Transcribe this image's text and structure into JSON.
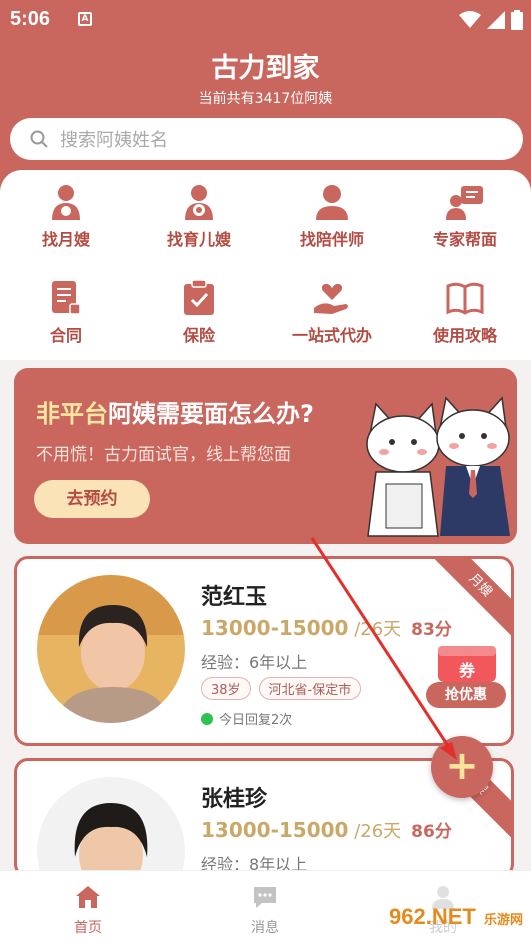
{
  "status_bar": {
    "time": "5:06",
    "notification_letter": "A"
  },
  "header": {
    "title": "古力到家",
    "subtitle": "当前共有3417位阿姨"
  },
  "search": {
    "placeholder": "搜索阿姨姓名"
  },
  "services": [
    {
      "label": "找月嫂",
      "icon": "maternity-nurse-icon"
    },
    {
      "label": "找育儿嫂",
      "icon": "nanny-icon"
    },
    {
      "label": "找陪伴师",
      "icon": "companion-icon"
    },
    {
      "label": "专家帮面",
      "icon": "expert-interview-icon"
    },
    {
      "label": "合同",
      "icon": "contract-icon"
    },
    {
      "label": "保险",
      "icon": "insurance-icon"
    },
    {
      "label": "一站式代办",
      "icon": "one-stop-service-icon"
    },
    {
      "label": "使用攻略",
      "icon": "guide-book-icon"
    }
  ],
  "banner": {
    "title_highlight": "非平台",
    "title_rest": "阿姨需要面怎么办?",
    "subtitle": "不用慌！古力面试官，线上帮您面",
    "button": "去预约"
  },
  "cards": [
    {
      "name": "范红玉",
      "price": "13000-15000",
      "unit": " /26天",
      "score": "83分",
      "experience": "经验：6年以上",
      "tags": [
        "38岁",
        "河北省-保定市"
      ],
      "reply": "今日回复2次",
      "badge": "月嫂"
    },
    {
      "name": "张桂珍",
      "price": "13000-15000",
      "unit": " /26天",
      "score": "86分",
      "experience": "经验：8年以上",
      "badge": "嫂"
    }
  ],
  "coupon": {
    "badge_text": "券",
    "button": "抢优惠"
  },
  "fab": {
    "label": "+"
  },
  "tabbar": {
    "items": [
      {
        "label": "首页",
        "icon": "home-icon"
      },
      {
        "label": "消息",
        "icon": "message-icon"
      },
      {
        "label": "我的",
        "icon": "profile-icon"
      }
    ]
  },
  "watermark": {
    "brand": "962",
    "domain": ".NET",
    "sub": "乐游网"
  },
  "colors": {
    "primary": "#c9665d",
    "accent_gold": "#c9a96a",
    "highlight_yellow": "#fde7a3",
    "online_green": "#2ec24e"
  }
}
